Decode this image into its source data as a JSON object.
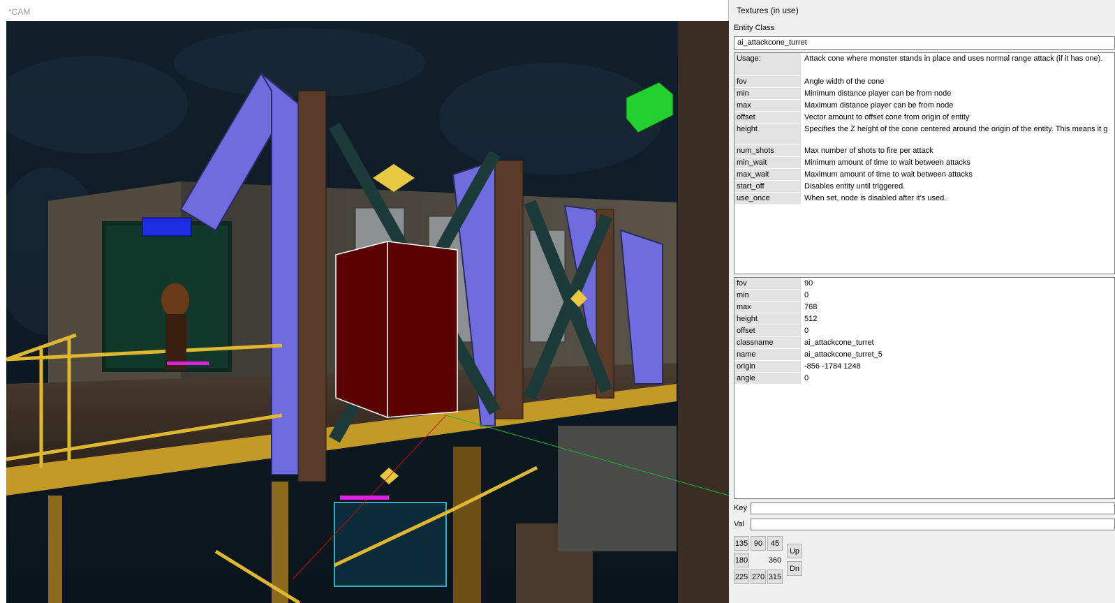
{
  "cam": {
    "title": "*CAM"
  },
  "panel": {
    "title": "Textures (in use)",
    "entity_class_label": "Entity Class",
    "entity_class_value": "ai_attackcone_turret",
    "description": [
      {
        "key": "Usage:",
        "value": "Attack cone where monster stands in place and uses normal range attack (if it has one)."
      },
      {
        "key": "fov",
        "value": "Angle width of the cone"
      },
      {
        "key": "min",
        "value": "Minimum distance player can be from node"
      },
      {
        "key": "max",
        "value": "Maximum distance player can be from node"
      },
      {
        "key": "offset",
        "value": "Vector amount to offset cone from origin of entity"
      },
      {
        "key": "height",
        "value": "Specifies the Z height of the cone centered around the origin of the entity.  This means it g"
      },
      {
        "key": "num_shots",
        "value": "Max number of shots to fire per attack"
      },
      {
        "key": "min_wait",
        "value": "Minimum amount of time to wait between attacks"
      },
      {
        "key": "max_wait",
        "value": "Maximum amount of time to wait between attacks"
      },
      {
        "key": "start_off",
        "value": "Disables entity until triggered."
      },
      {
        "key": "use_once",
        "value": "When set, node is disabled after it's used."
      }
    ],
    "properties": [
      {
        "key": "fov",
        "value": "90"
      },
      {
        "key": "min",
        "value": "0"
      },
      {
        "key": "max",
        "value": "768"
      },
      {
        "key": "height",
        "value": "512"
      },
      {
        "key": "offset",
        "value": "0"
      },
      {
        "key": "classname",
        "value": "ai_attackcone_turret"
      },
      {
        "key": "name",
        "value": "ai_attackcone_turret_5"
      },
      {
        "key": "origin",
        "value": "-856 -1784 1248"
      },
      {
        "key": "angle",
        "value": "0"
      }
    ],
    "key_label": "Key",
    "val_label": "Val",
    "key_value": "",
    "val_value": "",
    "angles": {
      "a135": "135",
      "a90": "90",
      "a45": "45",
      "a180": "180",
      "a360": "360",
      "a225": "225",
      "a270": "270",
      "a315": "315",
      "up": "Up",
      "dn": "Dn"
    }
  }
}
